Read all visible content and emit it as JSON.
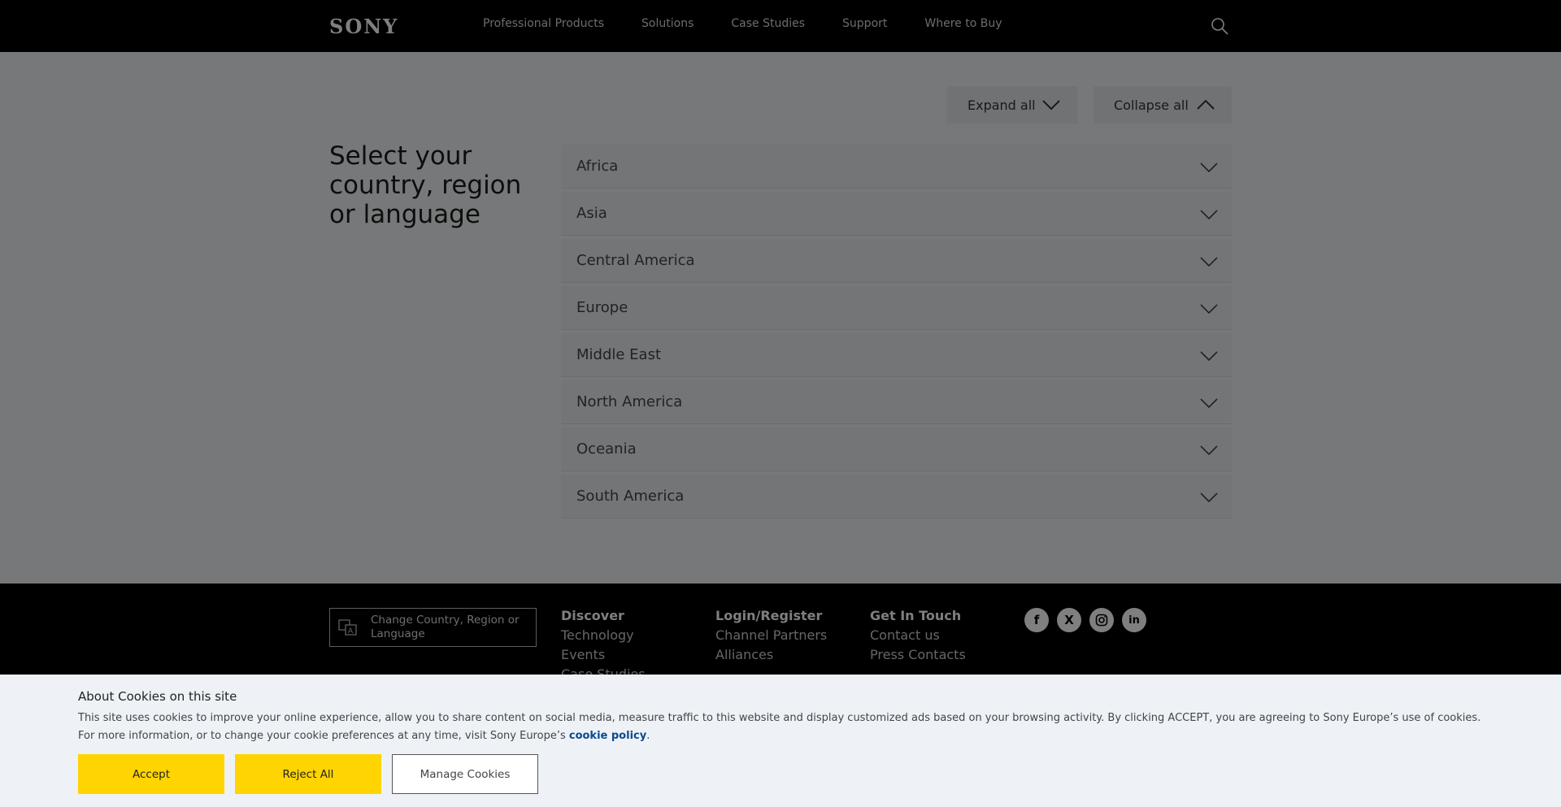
{
  "header": {
    "logo": "SONY",
    "nav": [
      "Professional Products",
      "Solutions",
      "Case Studies",
      "Support",
      "Where to Buy"
    ],
    "search_icon": "search-icon"
  },
  "main": {
    "expand_label": "Expand all",
    "collapse_label": "Collapse all",
    "title": "Select your country, region or language",
    "regions": [
      "Africa",
      "Asia",
      "Central America",
      "Europe",
      "Middle East",
      "North America",
      "Oceania",
      "South America"
    ]
  },
  "footer": {
    "change_country": "Change Country, Region or Language",
    "columns": [
      {
        "heading": "Discover",
        "links": [
          "Technology",
          "Events",
          "Case Studies"
        ]
      },
      {
        "heading": "Login/Register",
        "links": [
          "Channel Partners",
          "Alliances"
        ]
      },
      {
        "heading": "Get In Touch",
        "links": [
          "Contact us",
          "Press Contacts"
        ]
      }
    ],
    "socials": [
      "facebook-icon",
      "x-icon",
      "instagram-icon",
      "linkedin-icon"
    ]
  },
  "cookie": {
    "title": "About Cookies on this site",
    "text": "This site uses cookies to improve your online experience, allow you to share content on social media, measure traffic to this website and display customized ads based on your browsing activity. By clicking ACCEPT, you are agreeing to Sony Europe’s use of cookies. For more information, or to change your cookie preferences at any time, visit Sony Europe’s ",
    "link": "cookie policy",
    "text_end": ".",
    "accept": "Accept",
    "reject": "Reject All",
    "manage": "Manage Cookies"
  },
  "colors": {
    "accent": "#ffd400",
    "header_bg": "#000000"
  }
}
